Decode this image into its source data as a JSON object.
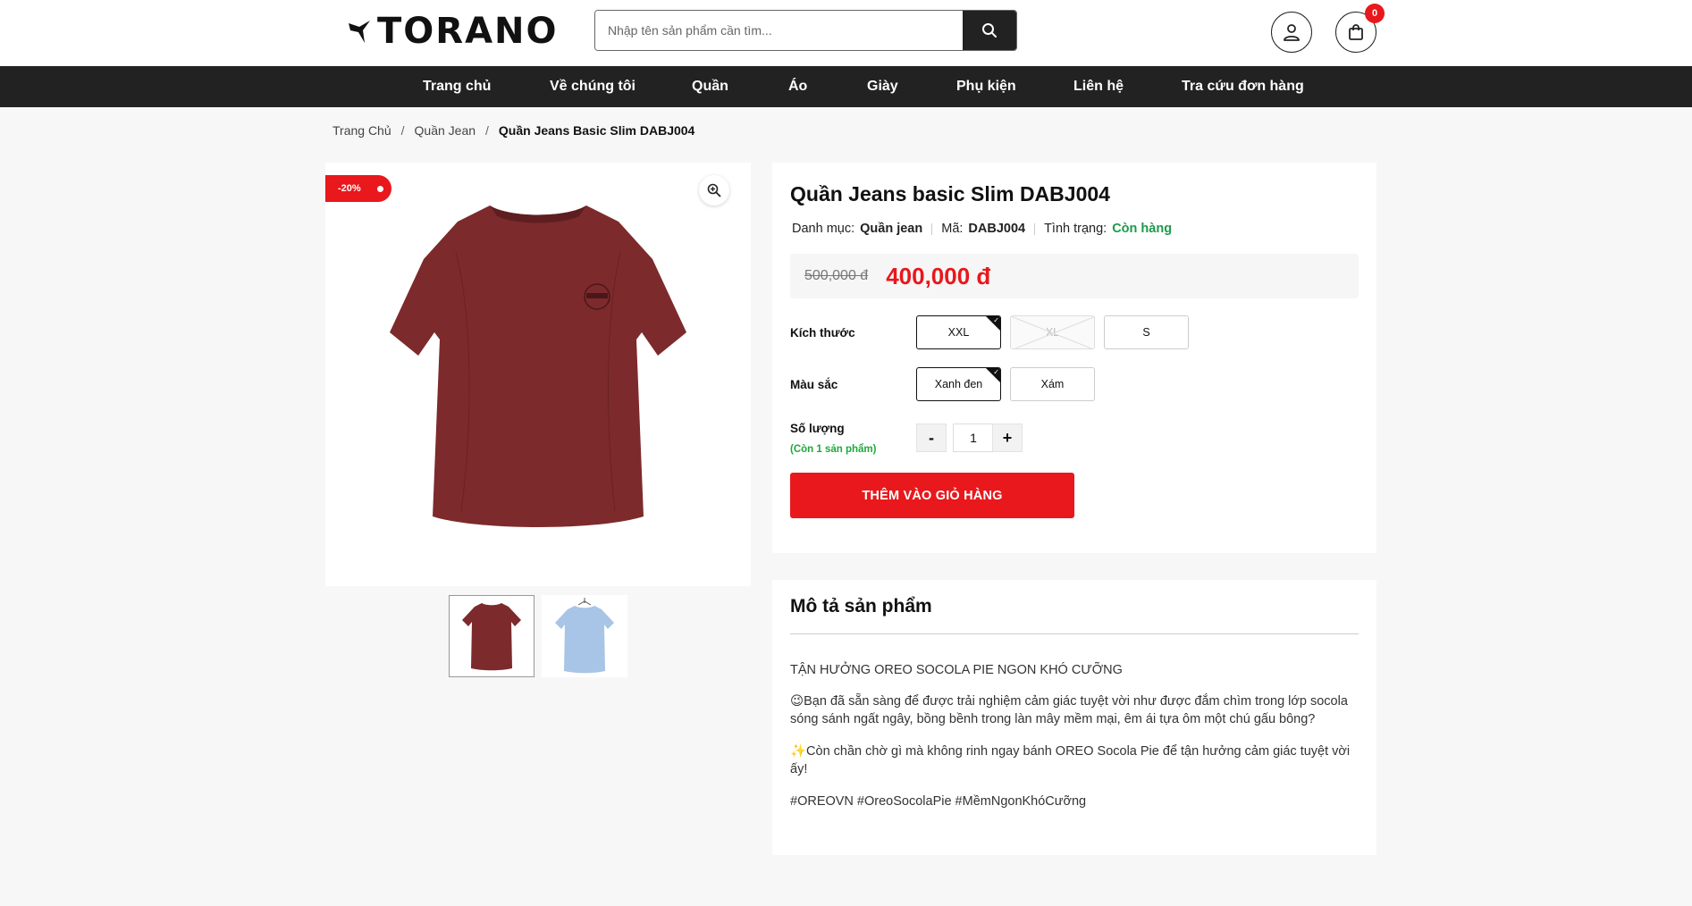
{
  "header": {
    "logo_text": "TORANO",
    "search_placeholder": "Nhập tên sản phẩm cần tìm...",
    "cart_count": "0"
  },
  "nav": {
    "items": [
      "Trang chủ",
      "Về chúng tôi",
      "Quần",
      "Áo",
      "Giày",
      "Phụ kiện",
      "Liên hệ",
      "Tra cứu đơn hàng"
    ]
  },
  "breadcrumb": {
    "home": "Trang Chủ",
    "category": "Quần Jean",
    "current": "Quần Jeans Basic Slim DABJ004"
  },
  "gallery": {
    "discount_badge": "-20%",
    "main_color": "#7d2a2c",
    "thumb_colors": [
      "#7d2a2c",
      "#a8c4e6"
    ]
  },
  "product": {
    "title": "Quần Jeans basic Slim DABJ004",
    "category_label": "Danh mục:",
    "category_value": "Quần jean",
    "code_label": "Mã:",
    "code_value": "DABJ004",
    "status_label": "Tình trạng:",
    "status_value": "Còn hàng",
    "old_price": "500,000 đ",
    "new_price": "400,000 đ",
    "size_label": "Kích thước",
    "sizes": [
      "XXL",
      "XL",
      "S"
    ],
    "selected_size": "XXL",
    "unavailable_size": "XL",
    "color_label": "Màu sắc",
    "colors": [
      "Xanh đen",
      "Xám"
    ],
    "selected_color": "Xanh đen",
    "qty_label": "Số lượng",
    "qty_note": "(Còn 1 sản phẩm)",
    "qty_minus": "-",
    "qty_value": "1",
    "qty_plus": "+",
    "add_to_cart": "THÊM VÀO GIỎ HÀNG"
  },
  "description": {
    "heading": "Mô tả sản phẩm",
    "p1": "TẬN HƯỞNG OREO SOCOLA PIE NGON KHÓ CƯỠNG",
    "p2": "😉Bạn đã sẵn sàng để được trải nghiệm cảm giác tuyệt vời như được đắm chìm trong lớp socola sóng sánh ngất ngây, bồng bềnh trong làn mây mềm mại, êm ái tựa ôm một chú gấu bông?",
    "p3": "✨Còn chần chờ gì mà không rinh ngay bánh OREO Socola Pie để tận hưởng cảm giác tuyệt vời ấy!",
    "p4": "#OREOVN #OreoSocolaPie #MềmNgonKhóCưỡng"
  }
}
